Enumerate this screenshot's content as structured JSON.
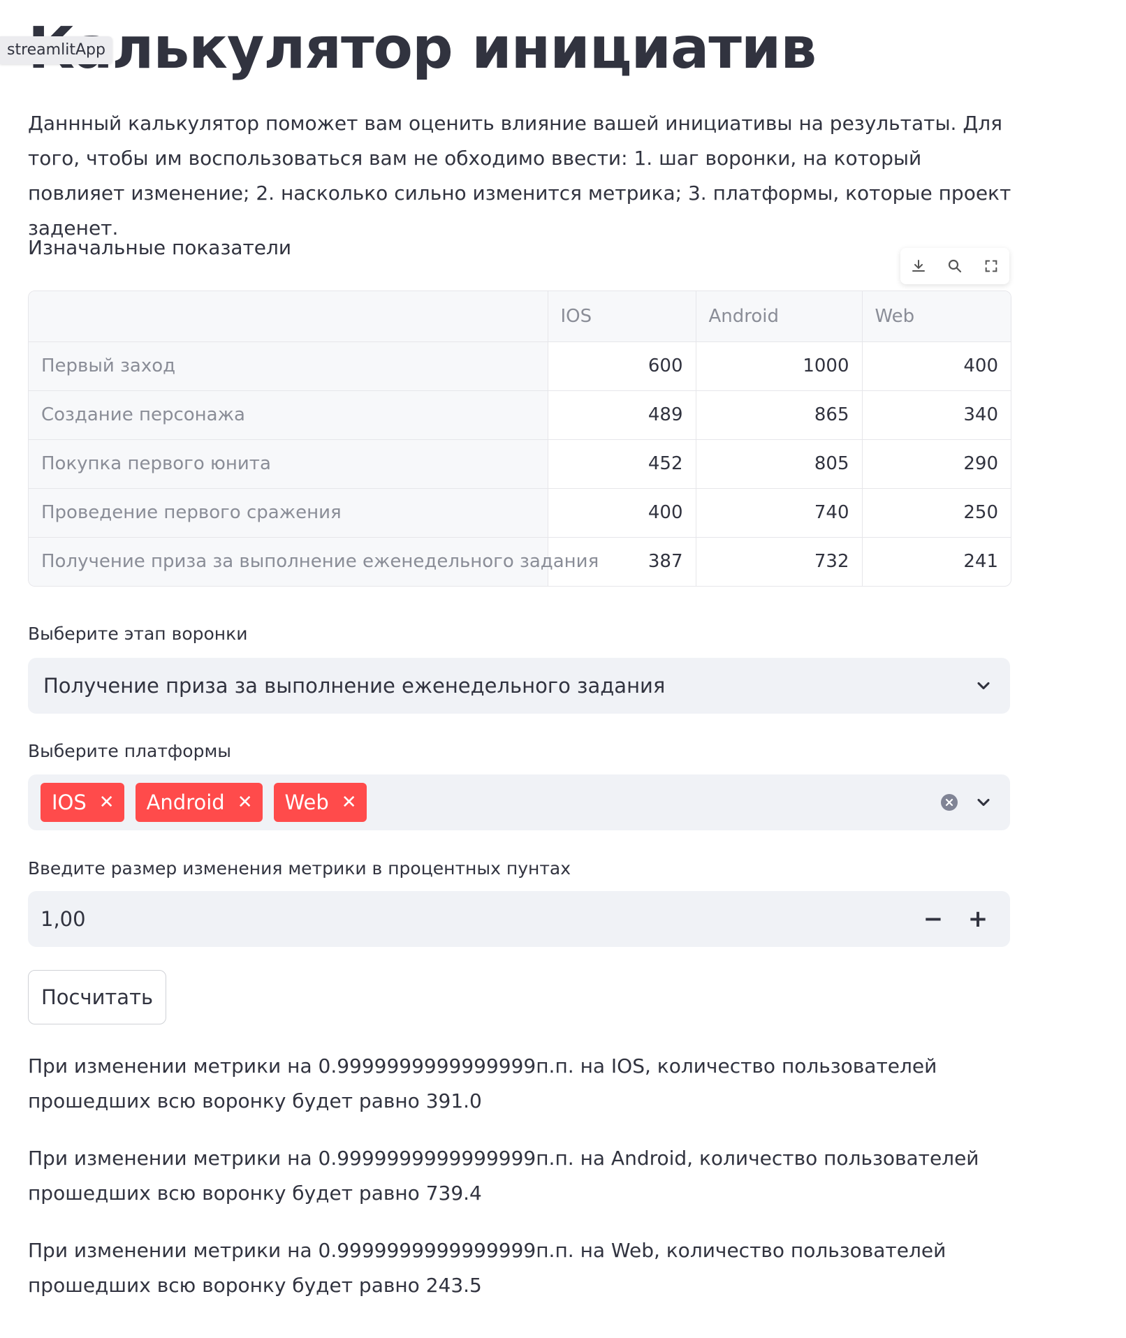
{
  "badge": "streamlitApp",
  "title": "Калькулятор инициатив",
  "intro": "Даннный калькулятор поможет вам оценить влияние вашей инициативы на результаты. Для того, чтобы им воспользоваться вам не обходимо ввести: 1. шаг воронки, на который повлияет изменение; 2. насколько сильно изменится метрика; 3. платформы, которые проект заденет.",
  "table_caption": "Изначальные показатели",
  "toolbar": {
    "download_icon": "download-icon",
    "search_icon": "search-icon",
    "fullscreen_icon": "fullscreen-icon"
  },
  "table": {
    "columns": [
      "",
      "IOS",
      "Android",
      "Web"
    ],
    "rows": [
      {
        "label": "Первый заход",
        "ios": "600",
        "android": "1000",
        "web": "400"
      },
      {
        "label": "Создание персонажа",
        "ios": "489",
        "android": "865",
        "web": "340"
      },
      {
        "label": "Покупка первого юнита",
        "ios": "452",
        "android": "805",
        "web": "290"
      },
      {
        "label": "Проведение первого сражения",
        "ios": "400",
        "android": "740",
        "web": "250"
      },
      {
        "label": "Получение приза за выполнение еженедельного задания",
        "ios": "387",
        "android": "732",
        "web": "241"
      }
    ]
  },
  "funnel_select": {
    "label": "Выберите этап воронки",
    "value": "Получение приза за выполнение еженедельного задания"
  },
  "platforms": {
    "label": "Выберите платформы",
    "tags": [
      "IOS",
      "Android",
      "Web"
    ]
  },
  "metric_input": {
    "label": "Введите размер изменения метрики в процентных пунтах",
    "value": "1,00",
    "minus": "−",
    "plus": "+"
  },
  "calc_button": "Посчитать",
  "results": [
    "При изменении метрики на 0.9999999999999999п.п. на IOS, количество пользователей прошедших всю воронку будет равно 391.0",
    "При изменении метрики на 0.9999999999999999п.п. на Android, количество пользователей прошедших всю воронку будет равно 739.4",
    "При изменении метрики на 0.9999999999999999п.п. на Web, количество пользователей прошедших всю воронку будет равно 243.5"
  ],
  "colors": {
    "tag": "#ff4b4b",
    "field_bg": "#f0f2f6",
    "text": "#31333f"
  }
}
